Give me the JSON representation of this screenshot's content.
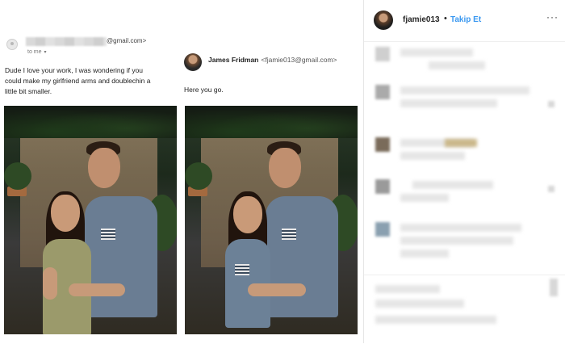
{
  "email_left": {
    "sender_domain": "@gmail.com>",
    "to_me": "to me",
    "body_lines": [
      "Dude I love your work, I was wondering if you",
      "could make my girlfriend arms and doublechin a",
      "little bit smaller."
    ]
  },
  "email_right": {
    "sender_name": "James Fridman",
    "sender_email": "<fjamie013@gmail.com>",
    "body": "Here you go."
  },
  "instagram": {
    "username": "fjamie013",
    "separator": "•",
    "follow_label": "Takip Et",
    "more_label": "···"
  },
  "colors": {
    "follow_blue": "#3897f0",
    "shirt_blue": "#6a7d93"
  }
}
